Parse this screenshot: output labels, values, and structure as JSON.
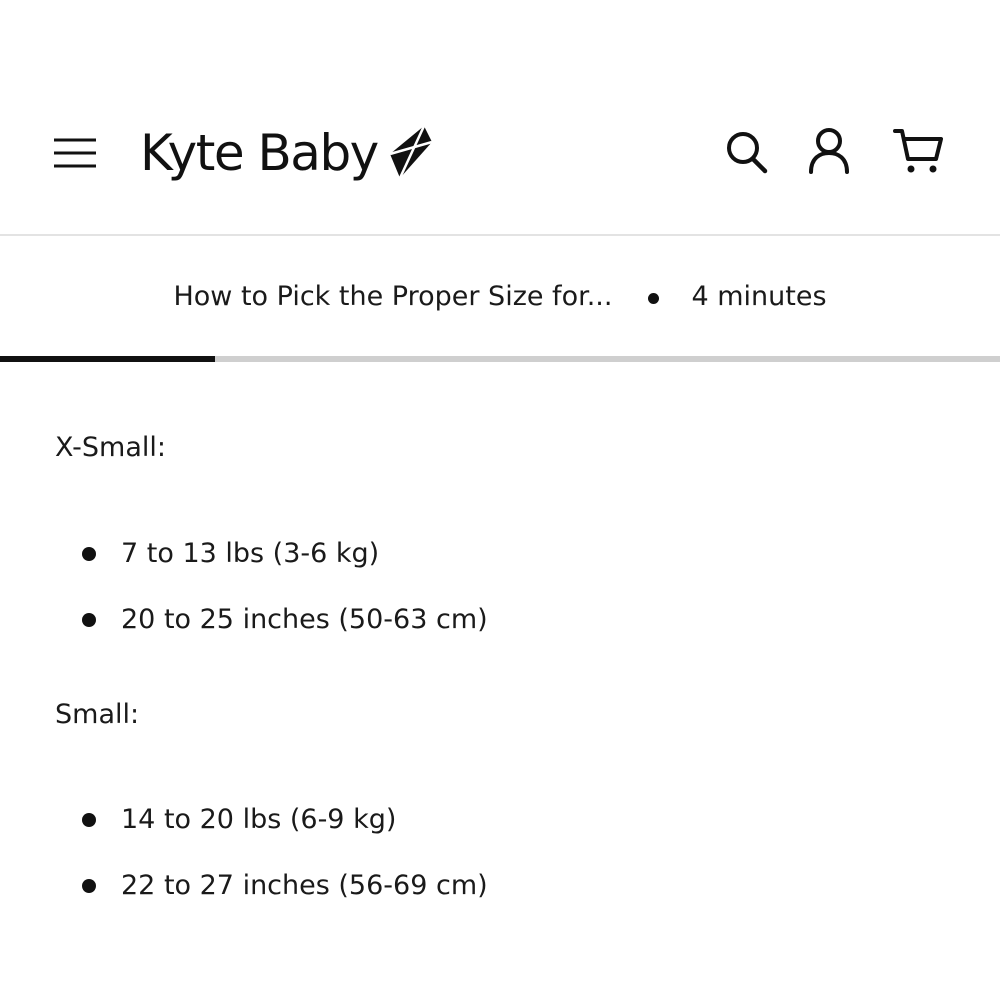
{
  "header": {
    "logo_text": "Kyte Baby",
    "icons": {
      "menu": "hamburger-menu-icon",
      "logo_mark": "kite-icon",
      "search": "search-icon",
      "account": "user-icon",
      "cart": "cart-icon"
    }
  },
  "article": {
    "title": "How to Pick the Proper Size for...",
    "read_time": "4 minutes",
    "progress": 0.215
  },
  "sections": [
    {
      "heading": "X-Small:",
      "items": [
        "7 to 13 lbs (3-6 kg)",
        "20 to 25 inches (50-63 cm)"
      ]
    },
    {
      "heading": "Small:",
      "items": [
        "14 to 20 lbs (6-9 kg)",
        "22 to 27 inches (56-69 cm)"
      ]
    }
  ],
  "colors": {
    "text": "#1a1a1a",
    "progress_fill": "#111111",
    "progress_track": "#cfcfcf",
    "divider": "#e3e3e3"
  }
}
